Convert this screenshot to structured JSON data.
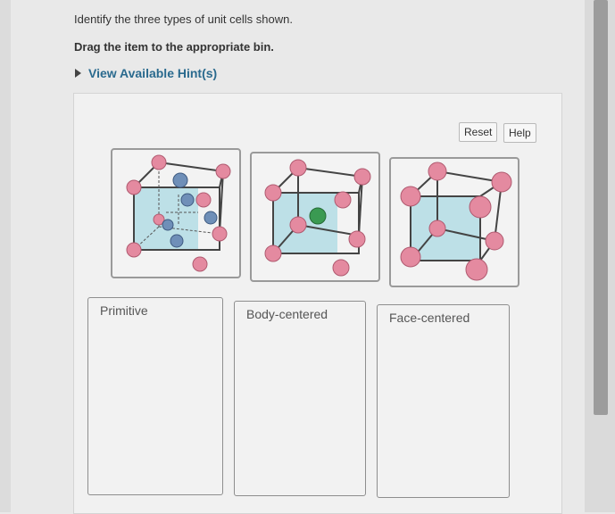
{
  "question": {
    "prompt": "Identify the three types of unit cells shown.",
    "instruction": "Drag the item to the appropriate bin.",
    "hint_link": "View Available Hint(s)"
  },
  "toolbar": {
    "reset_label": "Reset",
    "help_label": "Help"
  },
  "items": [
    {
      "name": "unit-cell-tile-1",
      "depicts": "cube with corner atoms and central atom"
    },
    {
      "name": "unit-cell-tile-2",
      "depicts": "cube with corner atoms and one green body-center atom"
    },
    {
      "name": "unit-cell-tile-3",
      "depicts": "cube with corner atoms only"
    }
  ],
  "bins": [
    {
      "label": "Primitive"
    },
    {
      "label": "Body-centered"
    },
    {
      "label": "Face-centered"
    }
  ],
  "colors": {
    "hint_link": "#2a6a8e",
    "atom_pink": "#e48aa0",
    "atom_blue": "#6f8fb8",
    "atom_green": "#3a9a52",
    "plane_teal": "#8fd0dd"
  }
}
